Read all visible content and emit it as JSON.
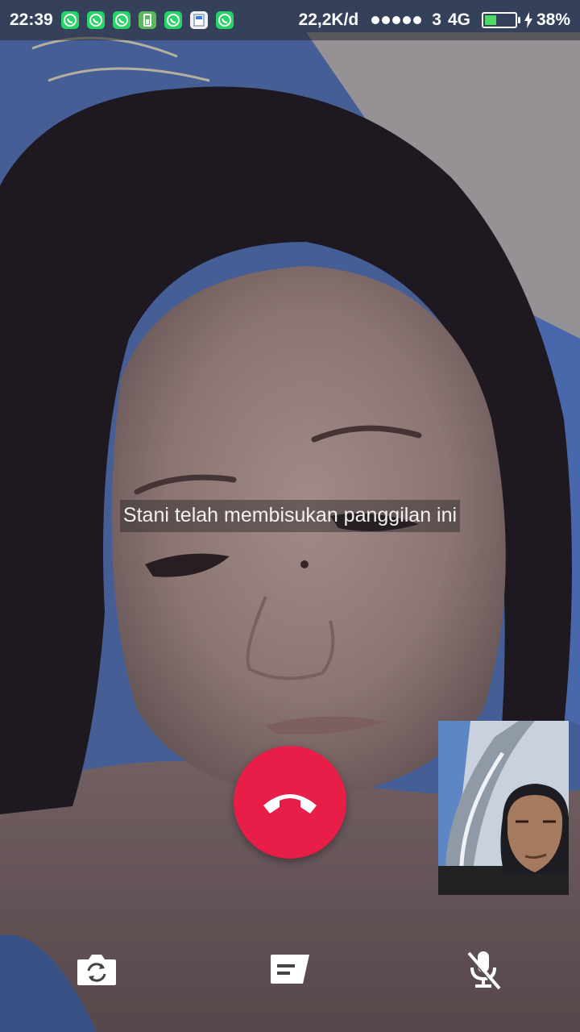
{
  "status_bar": {
    "time": "22:39",
    "notifications": [
      "whatsapp-icon",
      "whatsapp-icon",
      "whatsapp-icon",
      "battery-saver-icon",
      "whatsapp-icon",
      "app-update-icon",
      "whatsapp-icon"
    ],
    "net_speed": "22,2K/d",
    "sim": "3",
    "network_type": "4G",
    "battery_percent": "38%",
    "battery_level": 0.38,
    "charging": true
  },
  "call": {
    "muted_notice": "Stani telah membisukan panggilan ini",
    "end_call_icon": "phone-hangup-icon"
  },
  "controls": {
    "flip_camera_icon": "camera-switch-icon",
    "message_icon": "message-icon",
    "mute_icon": "mic-off-icon"
  },
  "colors": {
    "end_call": "#e91e48",
    "whatsapp_green": "#25d366",
    "battery_fill": "#4cd964"
  }
}
